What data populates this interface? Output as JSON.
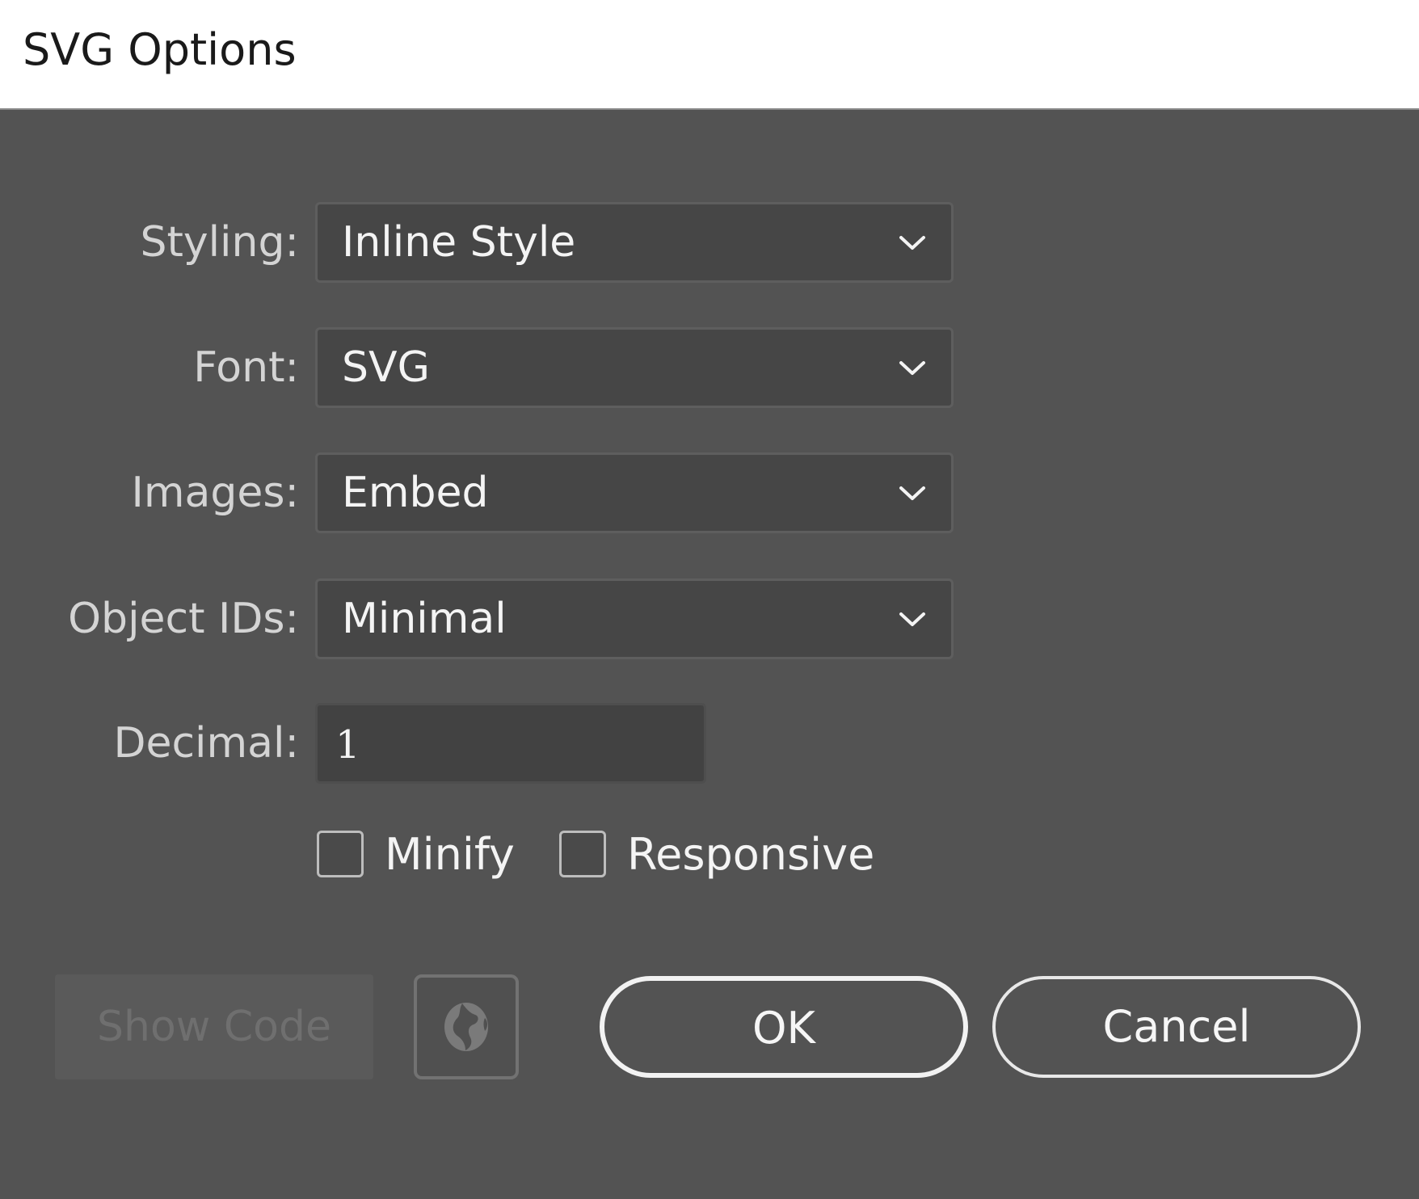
{
  "window": {
    "title": "SVG Options"
  },
  "form": {
    "styling": {
      "label": "Styling:",
      "value": "Inline Style"
    },
    "font": {
      "label": "Font:",
      "value": "SVG"
    },
    "images": {
      "label": "Images:",
      "value": "Embed"
    },
    "object_ids": {
      "label": "Object IDs:",
      "value": "Minimal"
    },
    "decimal": {
      "label": "Decimal:",
      "value": "1"
    },
    "minify": {
      "label": "Minify",
      "checked": false
    },
    "responsive": {
      "label": "Responsive",
      "checked": false
    }
  },
  "buttons": {
    "show_code": "Show Code",
    "globe_icon": "globe-icon",
    "ok": "OK",
    "cancel": "Cancel"
  },
  "colors": {
    "background": "#535353",
    "dropdown_bg": "#464646",
    "text": "#f4f4f4",
    "label_text": "#d4d4d4",
    "disabled_text": "#6f6f6f"
  }
}
